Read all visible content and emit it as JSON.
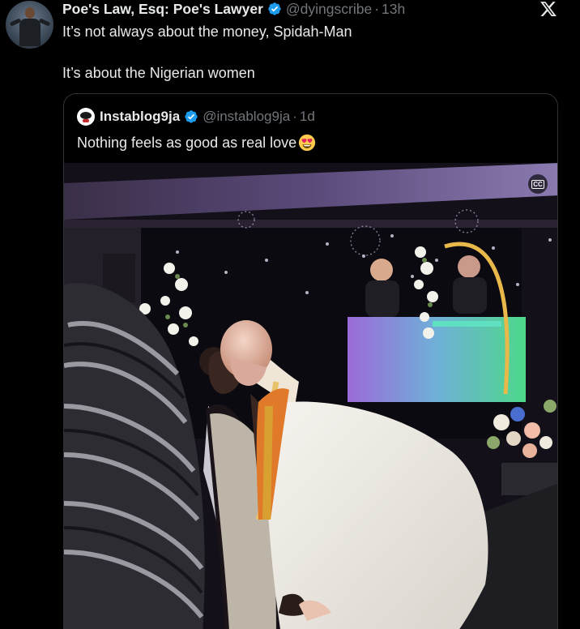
{
  "tweet": {
    "display_name": "Poe's Law, Esq: Poe's Lawyer",
    "handle": "@dyingscribe",
    "separator": "·",
    "time": "13h",
    "line1": "It’s not always about the money, Spidah-Man",
    "line2": "It’s about the Nigerian women"
  },
  "quote": {
    "display_name": "Instablog9ja",
    "handle": "@instablog9ja",
    "separator": "·",
    "time": "1d",
    "text": "Nothing feels as good as real love"
  },
  "media": {
    "cc_label": "CC"
  },
  "icons": {
    "avatar": "user-avatar",
    "verified": "verified-badge-icon",
    "close": "x-close-icon",
    "emoji": "heart-eyes-emoji-icon"
  },
  "colors": {
    "background": "#000000",
    "text": "#e7e9ea",
    "secondary": "#71767b",
    "verified": "#1d9bf0",
    "border": "#2f3336"
  }
}
